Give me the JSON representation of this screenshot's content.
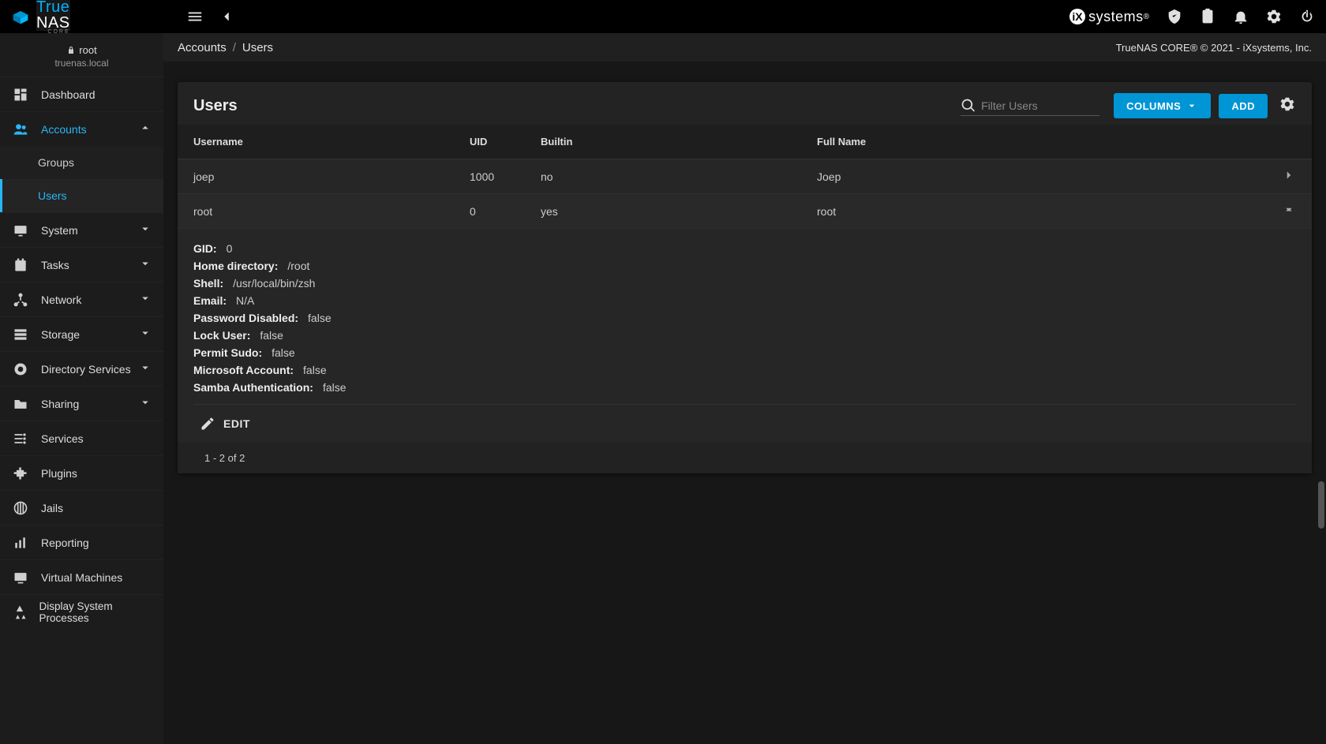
{
  "brand": {
    "true": "True",
    "nas": "NAS",
    "sub": "CORE"
  },
  "ix_brand": "systems",
  "topbar": {},
  "sidebar": {
    "user_label": "root",
    "host": "truenas.local",
    "items": [
      {
        "label": "Dashboard"
      },
      {
        "label": "Accounts"
      },
      {
        "label": "System"
      },
      {
        "label": "Tasks"
      },
      {
        "label": "Network"
      },
      {
        "label": "Storage"
      },
      {
        "label": "Directory Services"
      },
      {
        "label": "Sharing"
      },
      {
        "label": "Services"
      },
      {
        "label": "Plugins"
      },
      {
        "label": "Jails"
      },
      {
        "label": "Reporting"
      },
      {
        "label": "Virtual Machines"
      },
      {
        "label": "Display System Processes"
      }
    ],
    "sub_groups": "Groups",
    "sub_users": "Users"
  },
  "breadcrumb": {
    "a": "Accounts",
    "b": "Users"
  },
  "copyright": "TrueNAS CORE® © 2021 - iXsystems, Inc.",
  "page": {
    "title": "Users",
    "search_placeholder": "Filter Users",
    "columns_btn": "Columns",
    "add_btn": "Add"
  },
  "table": {
    "headers": {
      "username": "Username",
      "uid": "UID",
      "builtin": "Builtin",
      "fullname": "Full Name"
    },
    "rows": [
      {
        "username": "joep",
        "uid": "1000",
        "builtin": "no",
        "fullname": "Joep"
      },
      {
        "username": "root",
        "uid": "0",
        "builtin": "yes",
        "fullname": "root"
      }
    ],
    "footer": "1 - 2 of 2"
  },
  "detail": {
    "lines": [
      {
        "lbl": "GID:",
        "val": "0"
      },
      {
        "lbl": "Home directory:",
        "val": "/root"
      },
      {
        "lbl": "Shell:",
        "val": "/usr/local/bin/zsh"
      },
      {
        "lbl": "Email:",
        "val": "N/A"
      },
      {
        "lbl": "Password Disabled:",
        "val": "false"
      },
      {
        "lbl": "Lock User:",
        "val": "false"
      },
      {
        "lbl": "Permit Sudo:",
        "val": "false"
      },
      {
        "lbl": "Microsoft Account:",
        "val": "false"
      },
      {
        "lbl": "Samba Authentication:",
        "val": "false"
      }
    ],
    "edit": "EDIT"
  }
}
